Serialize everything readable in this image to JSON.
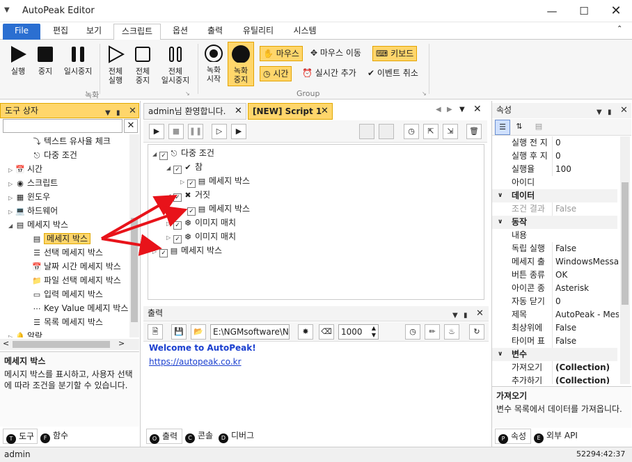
{
  "window": {
    "title": "AutoPeak Editor"
  },
  "ribbon_tabs": [
    "File",
    "편집",
    "보기",
    "스크립트",
    "옵션",
    "출력",
    "유틸리티",
    "시스템"
  ],
  "ribbon": {
    "record_buttons": [
      {
        "label1": "실행",
        "label2": ""
      },
      {
        "label1": "중지",
        "label2": ""
      },
      {
        "label1": "일시중지",
        "label2": ""
      },
      {
        "label1": "전체",
        "label2": "실행"
      },
      {
        "label1": "전체",
        "label2": "중지"
      },
      {
        "label1": "전체",
        "label2": "일시중지"
      }
    ],
    "group1_label": "녹화",
    "rec_start": {
      "label1": "녹화",
      "label2": "시작"
    },
    "rec_stop": {
      "label1": "녹화",
      "label2": "중지"
    },
    "small": [
      "마우스",
      "마우스 이동",
      "키보드",
      "시간",
      "실시간 추가",
      "이벤트 취소"
    ],
    "group2_label": "Group"
  },
  "toolbox": {
    "title": "도구 상자",
    "search_placeholder": "",
    "items": [
      "텍스트 유사율 체크",
      "다중 조건",
      "시간",
      "스크립트",
      "윈도우",
      "하드웨어",
      "메세지 박스",
      "메세지 박스",
      "선택 메세지 박스",
      "날짜 시간 메세지 박스",
      "파일 선택 메세지 박스",
      "입력 메세지 박스",
      "Key Value 메세지 박스",
      "목록 메세지 박스",
      "알람"
    ],
    "desc_title": "메세지 박스",
    "desc_text": "메시지 박스를 표시하고, 사용자 선택에 따라 조건을 분기할 수 있습니다.",
    "tabs": [
      "도구",
      "함수"
    ]
  },
  "editor": {
    "tabs": [
      "admin님 환영합니다.",
      "[NEW] Script 1"
    ],
    "tree": [
      "다중 조건",
      "참",
      "메세지 박스",
      "거짓",
      "메세지 박스",
      "이미지 매치",
      "이미지 매치",
      "메세지 박스"
    ]
  },
  "output": {
    "title": "출력",
    "path": "E:\\NGMsoftware\\NG",
    "number": "1000",
    "line1": "Welcome to AutoPeak!",
    "line2": "https://autopeak.co.kr",
    "tabs": [
      "출력",
      "콘솔",
      "디버그"
    ]
  },
  "properties": {
    "title": "속성",
    "rows": [
      {
        "k": "실행 전 지",
        "v": "0",
        "cat": false
      },
      {
        "k": "실행 후 지",
        "v": "0",
        "cat": false
      },
      {
        "k": "실행율",
        "v": "100",
        "cat": false
      },
      {
        "k": "아이디",
        "v": "",
        "cat": false
      },
      {
        "k": "데이터",
        "v": "",
        "cat": true
      },
      {
        "k": "조건 결과",
        "v": "False",
        "cat": false,
        "gray": true
      },
      {
        "k": "동작",
        "v": "",
        "cat": true
      },
      {
        "k": "내용",
        "v": "",
        "cat": false
      },
      {
        "k": "독립 실행",
        "v": "False",
        "cat": false
      },
      {
        "k": "메세지 출",
        "v": "WindowsMessage",
        "cat": false
      },
      {
        "k": "버튼 종류",
        "v": "OK",
        "cat": false
      },
      {
        "k": "아이콘 종",
        "v": "Asterisk",
        "cat": false
      },
      {
        "k": "자동 닫기",
        "v": "0",
        "cat": false
      },
      {
        "k": "제목",
        "v": "AutoPeak - Messa",
        "cat": false
      },
      {
        "k": "최상위에",
        "v": "False",
        "cat": false
      },
      {
        "k": "타이머 표",
        "v": "False",
        "cat": false
      },
      {
        "k": "변수",
        "v": "",
        "cat": true
      },
      {
        "k": "가져오기",
        "v": "(Collection)",
        "cat": false,
        "bold": true
      },
      {
        "k": "추가하기",
        "v": "(Collection)",
        "cat": false,
        "bold": true
      }
    ],
    "desc_title": "가져오기",
    "desc_text": "변수 목록에서 데이터를 가져옵니다.",
    "tabs": [
      "속성",
      "외부 API"
    ]
  },
  "status": {
    "user": "admin",
    "time": "52294:42:37"
  }
}
